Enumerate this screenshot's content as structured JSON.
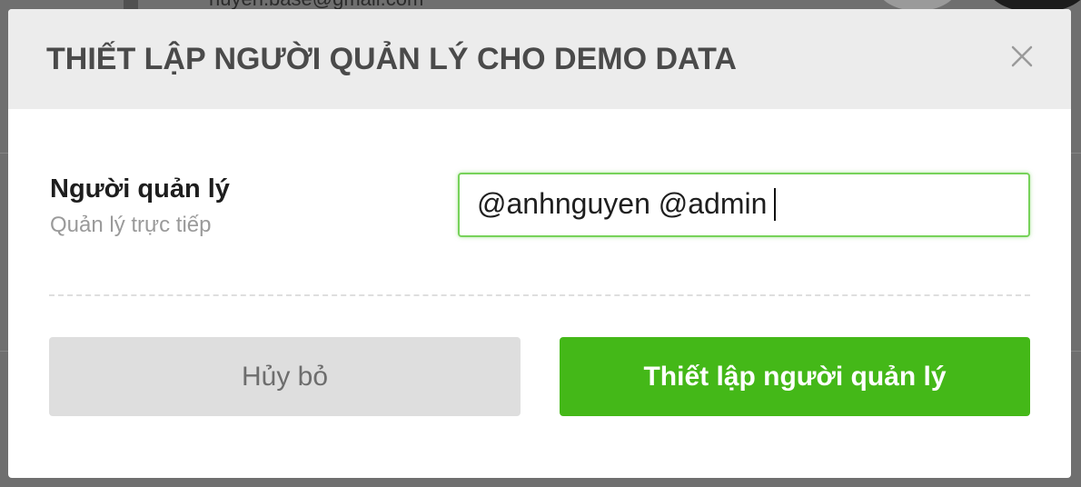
{
  "background": {
    "email_fragment": "nuyen.base@gmail.com"
  },
  "modal": {
    "title": "THIẾT LẬP NGƯỜI QUẢN LÝ CHO DEMO DATA",
    "close_icon": "close-icon",
    "field": {
      "label": "Người quản lý",
      "sublabel": "Quản lý trực tiếp",
      "value": "@anhnguyen @admin"
    },
    "buttons": {
      "cancel_label": "Hủy bỏ",
      "submit_label": "Thiết lập người quản lý"
    }
  },
  "colors": {
    "accent": "#44b818",
    "input_focus_border": "#77d25a",
    "header_bg": "#ececec",
    "overlay": "#6f6f6f",
    "cancel_bg": "#dedede"
  }
}
